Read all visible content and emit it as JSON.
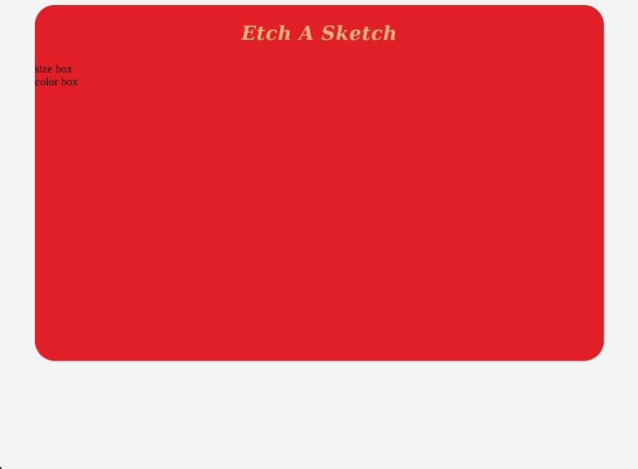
{
  "app": {
    "title": "Etch A Sketch"
  },
  "controls": {
    "size_box_label": "size box",
    "color_box_label": "color box"
  },
  "colors": {
    "page_background": "#f3f3f3",
    "frame_red": "#e01f26",
    "title_color": "#f3b47a"
  }
}
